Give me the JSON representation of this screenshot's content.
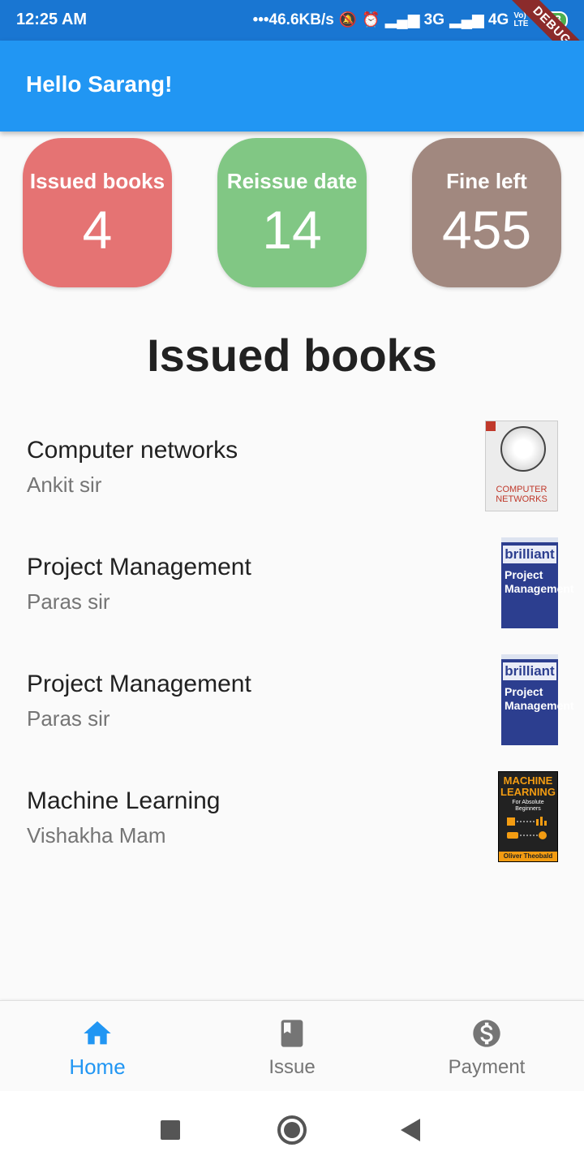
{
  "status_bar": {
    "time": "12:25 AM",
    "network_speed": "46.6KB/s",
    "signal_1": "3G",
    "signal_2": "4G",
    "volte": "Vo) LTE",
    "battery": "23",
    "debug_banner": "DEBUG"
  },
  "app_bar": {
    "title": "Hello Sarang!"
  },
  "stats": [
    {
      "label": "Issued books",
      "value": "4",
      "color": "#e57373"
    },
    {
      "label": "Reissue date",
      "value": "14",
      "color": "#81c784"
    },
    {
      "label": "Fine left",
      "value": "455",
      "color": "#a1887f"
    }
  ],
  "section_title": "Issued books",
  "books": [
    {
      "title": "Computer networks",
      "author": "Ankit sir",
      "cover": "computer-networks-cover",
      "cover_text": "COMPUTER NETWORKS"
    },
    {
      "title": "Project Management",
      "author": "Paras sir",
      "cover": "project-management-cover",
      "cover_text_1": "brilliant",
      "cover_text_2": "Project Management"
    },
    {
      "title": "Project Management",
      "author": "Paras sir",
      "cover": "project-management-cover",
      "cover_text_1": "brilliant",
      "cover_text_2": "Project Management"
    },
    {
      "title": "Machine Learning",
      "author": "Vishakha Mam",
      "cover": "machine-learning-cover",
      "cover_text_1": "MACHINE LEARNING",
      "cover_text_2": "For Absolute Beginners",
      "cover_author": "Oliver Theobald"
    }
  ],
  "bottom_nav": {
    "items": [
      {
        "label": "Home",
        "icon": "home-icon",
        "active": true
      },
      {
        "label": "Issue",
        "icon": "book-icon",
        "active": false
      },
      {
        "label": "Payment",
        "icon": "dollar-circle-icon",
        "active": false
      }
    ],
    "active_color": "#2196f3",
    "inactive_color": "#757575"
  },
  "system_nav": {
    "icons": [
      "recents-square-icon",
      "home-circle-icon",
      "back-triangle-icon"
    ]
  },
  "colors": {
    "primary": "#2196f3",
    "status_bar": "#1976d2"
  }
}
